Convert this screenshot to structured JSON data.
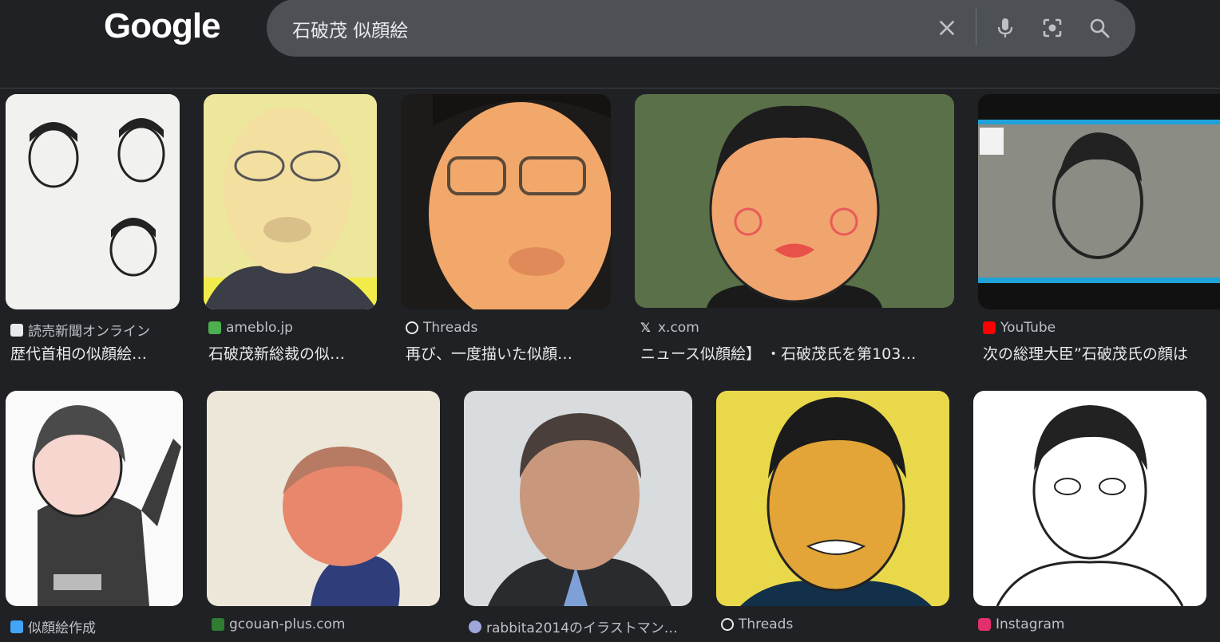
{
  "header": {
    "logo_text": "Google",
    "search_query": "石破茂 似顔絵",
    "icons": [
      "close-icon",
      "mic-icon",
      "lens-icon",
      "search-icon"
    ]
  },
  "results": [
    {
      "source": "読売新聞オンライン",
      "title": "歴代首相の似顔絵…",
      "favicon_color": "#e8eaed"
    },
    {
      "source": "ameblo.jp",
      "title": "石破茂新総裁の似…",
      "favicon_color": "#4caf50"
    },
    {
      "source": "Threads",
      "title": "再び、一度描いた似顔…",
      "favicon_color": "#e8eaed"
    },
    {
      "source": "x.com",
      "title": "ニュース似顔絵】 ・石破茂氏を第103…",
      "favicon_color": "#e8eaed"
    },
    {
      "source": "YouTube",
      "title": "次の総理大臣”石破茂氏の顔は",
      "favicon_color": "#ff0000"
    },
    {
      "source": "似顔絵作成",
      "title": "",
      "favicon_color": "#42a5f5"
    },
    {
      "source": "gcouan-plus.com",
      "title": "",
      "favicon_color": "#2e7d32"
    },
    {
      "source": "rabbita2014のイラストマン…",
      "title": "",
      "favicon_color": "#9fa8da"
    },
    {
      "source": "Threads",
      "title": "",
      "favicon_color": "#e8eaed"
    },
    {
      "source": "Instagram",
      "title": "",
      "favicon_color": "#e1306c"
    }
  ]
}
